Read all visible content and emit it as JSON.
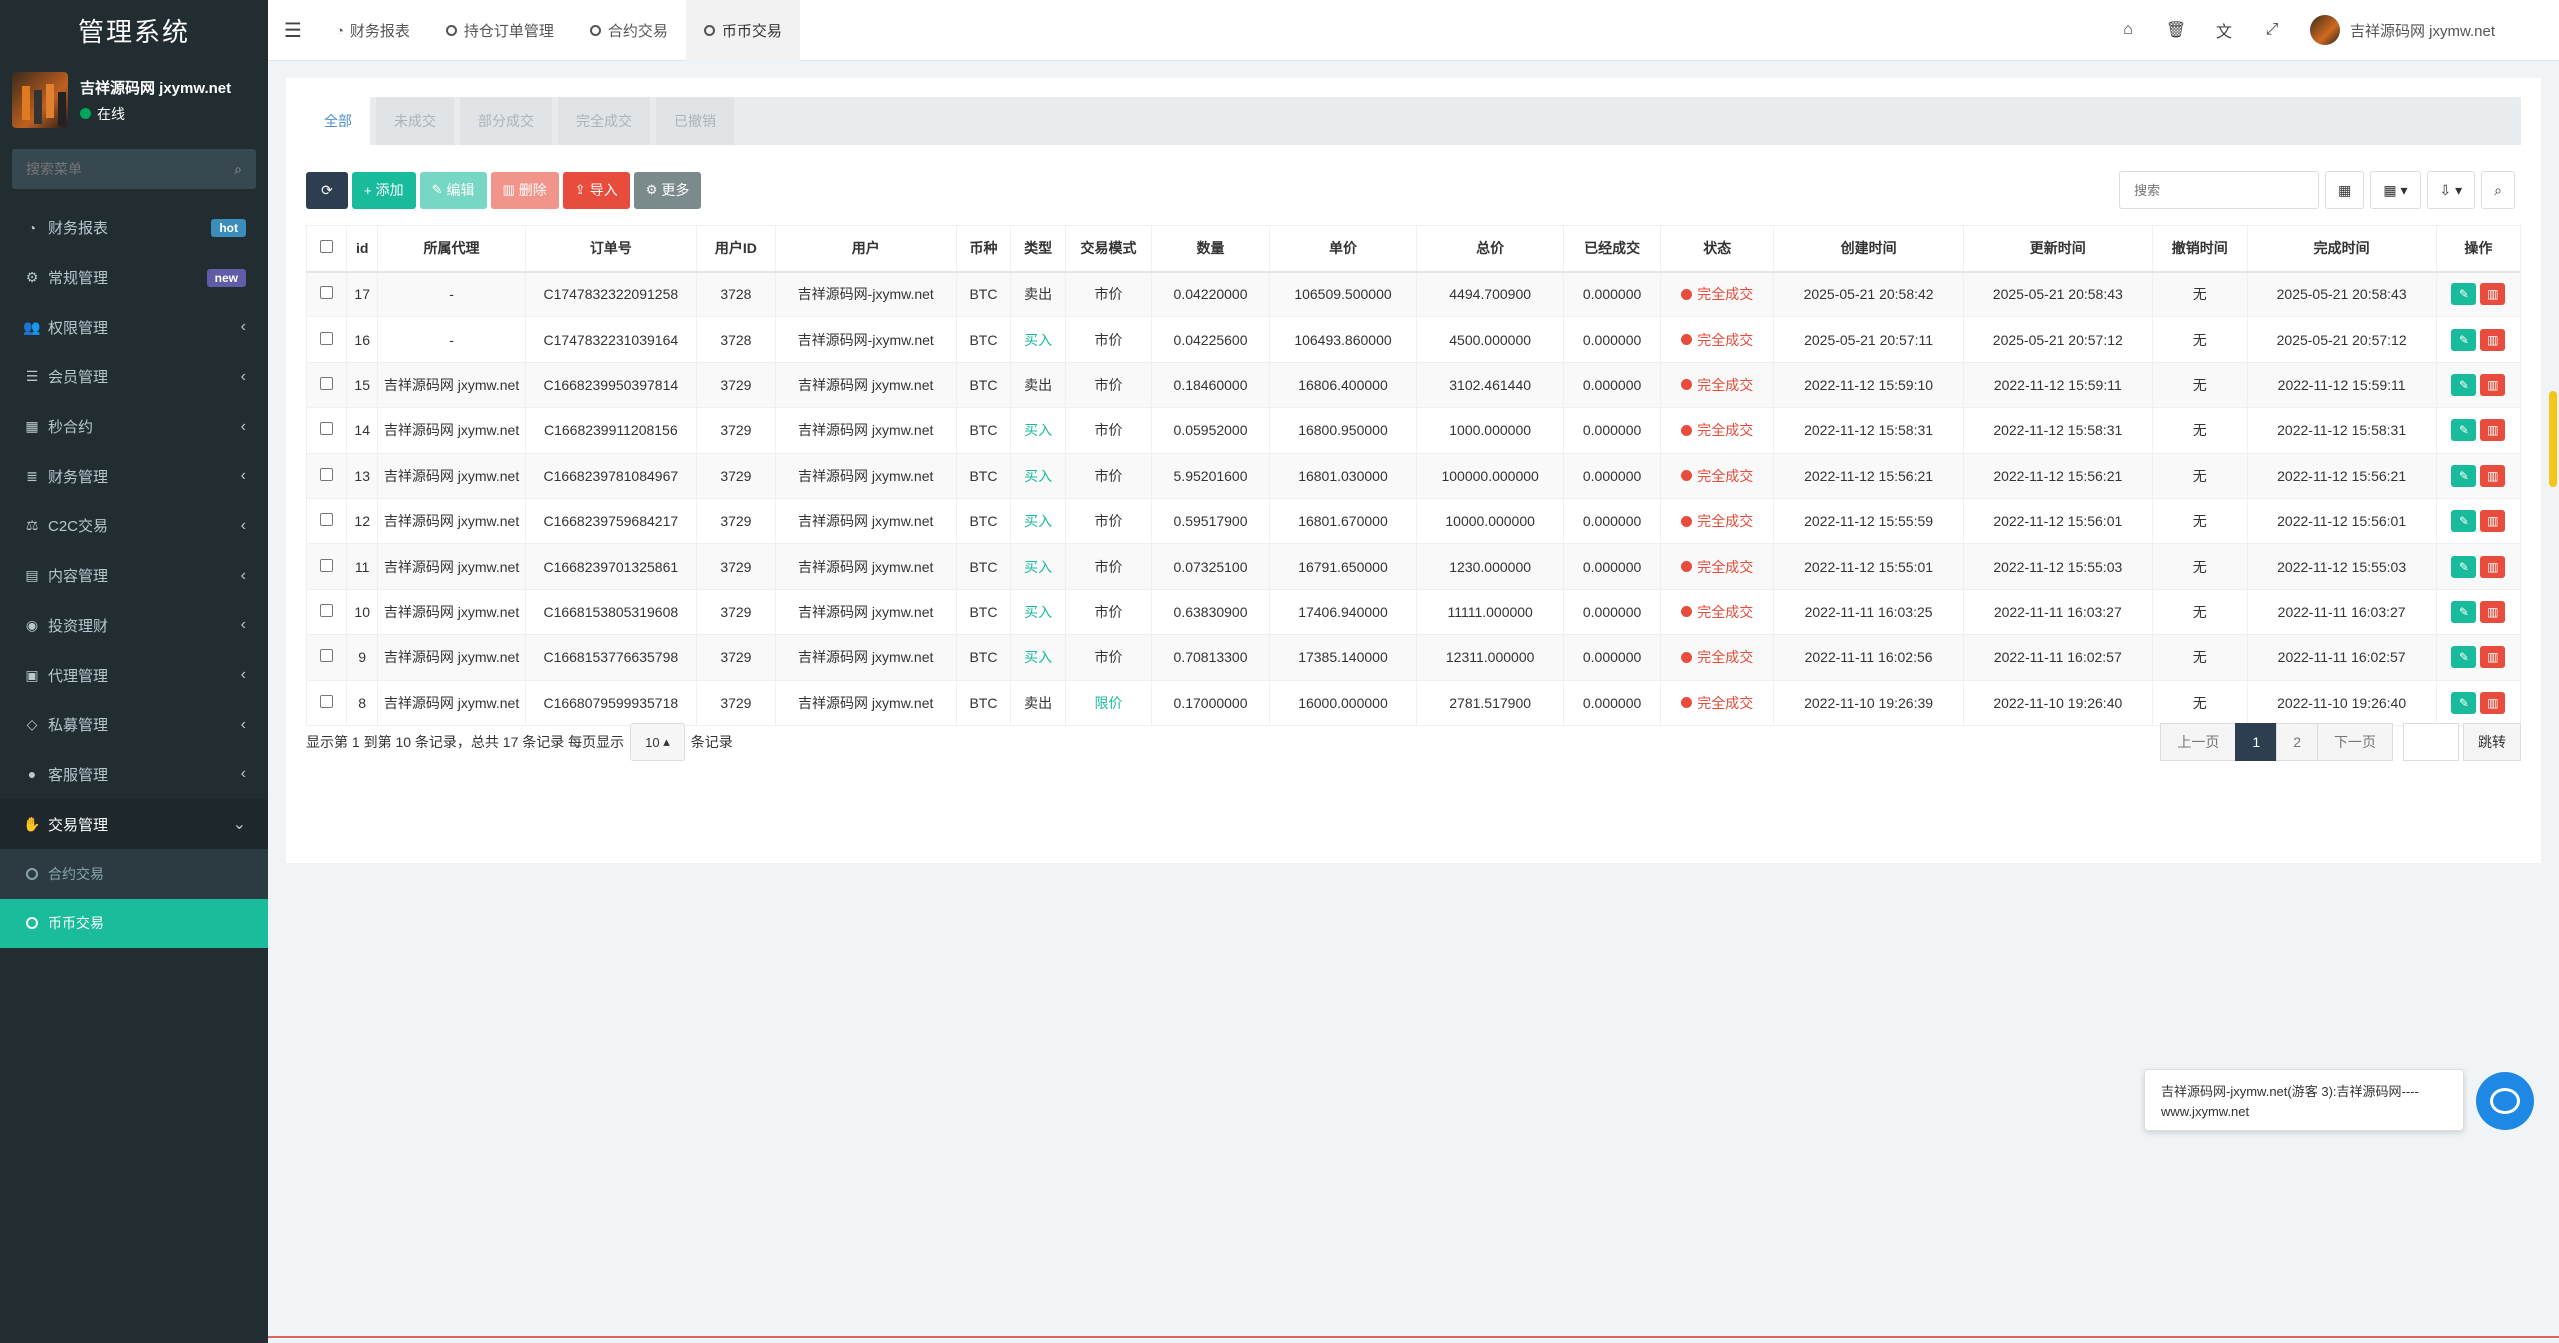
{
  "brand": "管理系统",
  "user": {
    "name": "吉祥源码网 jxymw.net",
    "status": "在线"
  },
  "sidebar": {
    "search_placeholder": "搜索菜单",
    "items": [
      {
        "icon": "dashboard-icon",
        "glyph": "◔",
        "label": "财务报表",
        "badge": "hot"
      },
      {
        "icon": "cogs-icon",
        "glyph": "⚙",
        "label": "常规管理",
        "badge": "new"
      },
      {
        "icon": "group-icon",
        "glyph": "👥",
        "label": "权限管理",
        "arrow": "‹"
      },
      {
        "icon": "list-icon",
        "glyph": "☰",
        "label": "会员管理",
        "arrow": "‹"
      },
      {
        "icon": "calendar-icon",
        "glyph": "▦",
        "label": "秒合约",
        "arrow": "‹"
      },
      {
        "icon": "database-icon",
        "glyph": "≣",
        "label": "财务管理",
        "arrow": "‹"
      },
      {
        "icon": "balance-scale-icon",
        "glyph": "⚖",
        "label": "C2C交易",
        "arrow": "‹"
      },
      {
        "icon": "newspaper-icon",
        "glyph": "▤",
        "label": "内容管理",
        "arrow": "‹"
      },
      {
        "icon": "compass-icon",
        "glyph": "◉",
        "label": "投资理财",
        "arrow": "‹"
      },
      {
        "icon": "briefcase-icon",
        "glyph": "▣",
        "label": "代理管理",
        "arrow": "‹"
      },
      {
        "icon": "diamond-icon",
        "glyph": "◇",
        "label": "私募管理",
        "arrow": "‹"
      },
      {
        "icon": "comment-icon",
        "glyph": "●",
        "label": "客服管理",
        "arrow": "‹"
      },
      {
        "icon": "handshake-icon",
        "glyph": "✋",
        "label": "交易管理",
        "arrow": "⌄"
      }
    ],
    "submenu": [
      "合约交易",
      "币币交易"
    ]
  },
  "topbar": {
    "tabs": [
      {
        "label": "财务报表",
        "icon": "dashboard-icon",
        "glyph": "◔"
      },
      {
        "label": "持仓订单管理",
        "icon": "circle-o-icon"
      },
      {
        "label": "合约交易",
        "icon": "circle-o-icon"
      },
      {
        "label": "币币交易",
        "icon": "circle-o-icon"
      }
    ],
    "user_name": "吉祥源码网 jxymw.net"
  },
  "status_tabs": [
    "全部",
    "未成交",
    "部分成交",
    "完全成交",
    "已撤销"
  ],
  "toolbar": {
    "add": "添加",
    "edit": "编辑",
    "delete": "删除",
    "import": "导入",
    "more": "更多",
    "search_placeholder": "搜索"
  },
  "table": {
    "headers": [
      "id",
      "所属代理",
      "订单号",
      "用户ID",
      "用户",
      "币种",
      "类型",
      "交易模式",
      "数量",
      "单价",
      "总价",
      "已经成交",
      "状态",
      "创建时间",
      "更新时间",
      "撤销时间",
      "完成时间",
      "操作"
    ],
    "rows": [
      [
        "17",
        "-",
        "C1747832322091258",
        "3728",
        "吉祥源码网-jxymw.net",
        "BTC",
        "卖出",
        "市价",
        "0.04220000",
        "106509.500000",
        "4494.700900",
        "0.000000",
        "完全成交",
        "2025-05-21 20:58:42",
        "2025-05-21 20:58:43",
        "无",
        "2025-05-21 20:58:43"
      ],
      [
        "16",
        "-",
        "C1747832231039164",
        "3728",
        "吉祥源码网-jxymw.net",
        "BTC",
        "买入",
        "市价",
        "0.04225600",
        "106493.860000",
        "4500.000000",
        "0.000000",
        "完全成交",
        "2025-05-21 20:57:11",
        "2025-05-21 20:57:12",
        "无",
        "2025-05-21 20:57:12"
      ],
      [
        "15",
        "吉祥源码网 jxymw.net",
        "C1668239950397814",
        "3729",
        "吉祥源码网 jxymw.net",
        "BTC",
        "卖出",
        "市价",
        "0.18460000",
        "16806.400000",
        "3102.461440",
        "0.000000",
        "完全成交",
        "2022-11-12 15:59:10",
        "2022-11-12 15:59:11",
        "无",
        "2022-11-12 15:59:11"
      ],
      [
        "14",
        "吉祥源码网 jxymw.net",
        "C1668239911208156",
        "3729",
        "吉祥源码网 jxymw.net",
        "BTC",
        "买入",
        "市价",
        "0.05952000",
        "16800.950000",
        "1000.000000",
        "0.000000",
        "完全成交",
        "2022-11-12 15:58:31",
        "2022-11-12 15:58:31",
        "无",
        "2022-11-12 15:58:31"
      ],
      [
        "13",
        "吉祥源码网 jxymw.net",
        "C1668239781084967",
        "3729",
        "吉祥源码网 jxymw.net",
        "BTC",
        "买入",
        "市价",
        "5.95201600",
        "16801.030000",
        "100000.000000",
        "0.000000",
        "完全成交",
        "2022-11-12 15:56:21",
        "2022-11-12 15:56:21",
        "无",
        "2022-11-12 15:56:21"
      ],
      [
        "12",
        "吉祥源码网 jxymw.net",
        "C1668239759684217",
        "3729",
        "吉祥源码网 jxymw.net",
        "BTC",
        "买入",
        "市价",
        "0.59517900",
        "16801.670000",
        "10000.000000",
        "0.000000",
        "完全成交",
        "2022-11-12 15:55:59",
        "2022-11-12 15:56:01",
        "无",
        "2022-11-12 15:56:01"
      ],
      [
        "11",
        "吉祥源码网 jxymw.net",
        "C1668239701325861",
        "3729",
        "吉祥源码网 jxymw.net",
        "BTC",
        "买入",
        "市价",
        "0.07325100",
        "16791.650000",
        "1230.000000",
        "0.000000",
        "完全成交",
        "2022-11-12 15:55:01",
        "2022-11-12 15:55:03",
        "无",
        "2022-11-12 15:55:03"
      ],
      [
        "10",
        "吉祥源码网 jxymw.net",
        "C1668153805319608",
        "3729",
        "吉祥源码网 jxymw.net",
        "BTC",
        "买入",
        "市价",
        "0.63830900",
        "17406.940000",
        "11111.000000",
        "0.000000",
        "完全成交",
        "2022-11-11 16:03:25",
        "2022-11-11 16:03:27",
        "无",
        "2022-11-11 16:03:27"
      ],
      [
        "9",
        "吉祥源码网 jxymw.net",
        "C1668153776635798",
        "3729",
        "吉祥源码网 jxymw.net",
        "BTC",
        "买入",
        "市价",
        "0.70813300",
        "17385.140000",
        "12311.000000",
        "0.000000",
        "完全成交",
        "2022-11-11 16:02:56",
        "2022-11-11 16:02:57",
        "无",
        "2022-11-11 16:02:57"
      ],
      [
        "8",
        "吉祥源码网 jxymw.net",
        "C1668079599935718",
        "3729",
        "吉祥源码网 jxymw.net",
        "BTC",
        "卖出",
        "限价",
        "0.17000000",
        "16000.000000",
        "2781.517900",
        "0.000000",
        "完全成交",
        "2022-11-10 19:26:39",
        "2022-11-10 19:26:40",
        "无",
        "2022-11-10 19:26:40"
      ]
    ]
  },
  "footer": {
    "info_prefix": "显示第 1 到第 10 条记录，总共 17 条记录 每页显示",
    "page_size": "10",
    "info_suffix": "条记录"
  },
  "pager": {
    "prev": "上一页",
    "pages": [
      "1",
      "2"
    ],
    "next": "下一页",
    "jump": "跳转"
  },
  "chat": {
    "message": "吉祥源码网-jxymw.net(游客 3):吉祥源码网----www.jxymw.net"
  },
  "colors": {
    "sidebar_bg": "#222d32",
    "accent": "#18bc9c",
    "danger": "#e74c3c",
    "primary_dark": "#2c3e50"
  }
}
